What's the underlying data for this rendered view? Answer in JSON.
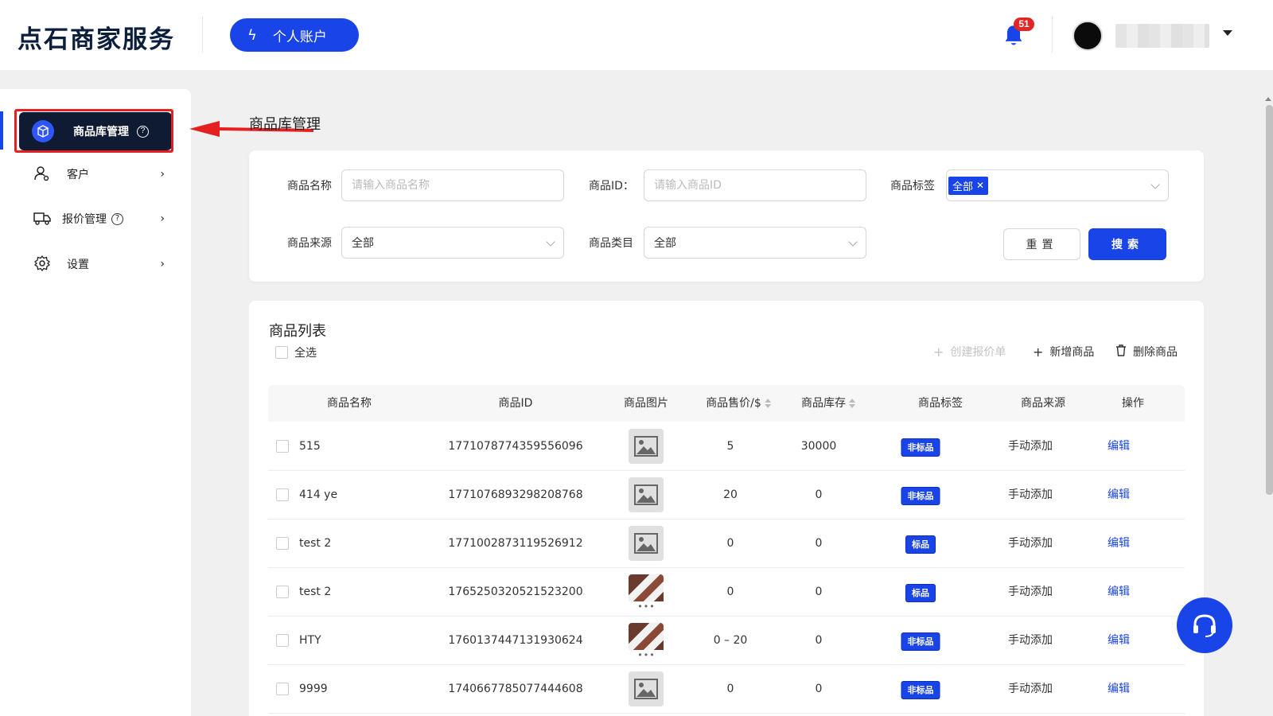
{
  "header": {
    "logo": "点石商家服务",
    "account_button": "个人账户",
    "notification_count": "51"
  },
  "sidebar": {
    "items": [
      {
        "label": "商品库管理",
        "active": true
      },
      {
        "label": "客户"
      },
      {
        "label": "报价管理"
      },
      {
        "label": "设置"
      }
    ]
  },
  "page": {
    "title": "商品库管理"
  },
  "filters": {
    "name_label": "商品名称",
    "name_placeholder": "请输入商品名称",
    "id_label": "商品ID：",
    "id_placeholder": "请输入商品ID",
    "tag_label": "商品标签",
    "tag_selected": "全部",
    "source_label": "商品来源",
    "source_value": "全部",
    "category_label": "商品类目",
    "category_value": "全部",
    "reset_label": "重置",
    "search_label": "搜索"
  },
  "list": {
    "title": "商品列表",
    "select_all": "全选",
    "actions": {
      "create_quote": "创建报价单",
      "add_product": "新增商品",
      "delete_product": "删除商品"
    },
    "columns": [
      "商品名称",
      "商品ID",
      "商品图片",
      "商品售价/$",
      "商品库存",
      "商品标签",
      "商品来源",
      "操作"
    ],
    "rows": [
      {
        "name": "515",
        "id": "1771078774359556096",
        "image": "placeholder",
        "price": "5",
        "stock": "30000",
        "tag": "非标品",
        "source": "手动添加",
        "action": "编辑"
      },
      {
        "name": "414 ye",
        "id": "1771076893298208768",
        "image": "placeholder",
        "price": "20",
        "stock": "0",
        "tag": "非标品",
        "source": "手动添加",
        "action": "编辑"
      },
      {
        "name": "test 2",
        "id": "1771002873119526912",
        "image": "placeholder",
        "price": "0",
        "stock": "0",
        "tag": "标品",
        "source": "手动添加",
        "action": "编辑"
      },
      {
        "name": "test 2",
        "id": "1765250320521523200",
        "image": "photo",
        "price": "0",
        "stock": "0",
        "tag": "标品",
        "source": "手动添加",
        "action": "编辑"
      },
      {
        "name": "HTY",
        "id": "1760137447131930624",
        "image": "photo",
        "price": "0 – 20",
        "stock": "0",
        "tag": "非标品",
        "source": "手动添加",
        "action": "编辑"
      },
      {
        "name": "9999",
        "id": "1740667785077444608",
        "image": "placeholder",
        "price": "0",
        "stock": "0",
        "tag": "非标品",
        "source": "手动添加",
        "action": "编辑"
      }
    ]
  },
  "colors": {
    "primary": "#1944e8",
    "sidebar_active": "#0f1a33",
    "highlight": "#e52020"
  }
}
